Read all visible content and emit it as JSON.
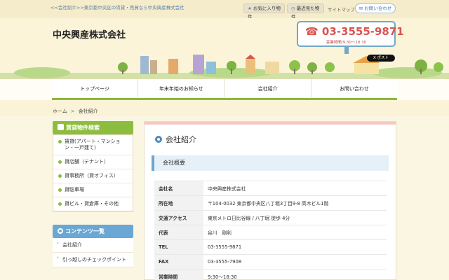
{
  "top": {
    "breadcrumb": "<<会社紹介>>東京都中央区の賃貸・売買なら中央興産株式会社",
    "favorite": "お気に入り物件",
    "recent": "最近見た物件",
    "sitemap": "サイトマップ",
    "contact": "お問い合わせ"
  },
  "header": {
    "company": "中央興産株式会社",
    "phone": "03-3555-9871",
    "hours": "営業時間/9:30〜18:30",
    "post": "X ポスト"
  },
  "nav": [
    "トップページ",
    "年末年始のお知らせ",
    "会社紹介",
    "お問い合わせ"
  ],
  "breadcrumb": {
    "home": "ホーム",
    "sep": ">",
    "current": "会社紹介"
  },
  "sidebar": {
    "rent_title": "賃貸物件検索",
    "rent_items": [
      "賃貸(アパート・マンション・一戸建て)",
      "貸店舗（テナント）",
      "貸事務所（貸オフィス）",
      "貸駐車場",
      "貸ビル・貸倉庫・その他"
    ],
    "contents_title": "コンテンツ一覧",
    "contents_items": [
      "会社紹介",
      "引っ越しのチェックポイント"
    ]
  },
  "main": {
    "title": "会社紹介",
    "section": "会社概要",
    "rows": [
      {
        "k": "会社名",
        "v": "中央興産株式会社"
      },
      {
        "k": "所在地",
        "v": "〒104-0032 東京都中央区八丁堀3丁目9-8 高木ビル1階"
      },
      {
        "k": "交通アクセス",
        "v": "東京メトロ日比谷線 / 八丁堀 徒歩 4分"
      },
      {
        "k": "代表",
        "v": "谷川　剛利"
      },
      {
        "k": "TEL",
        "v": "03-3555-9871"
      },
      {
        "k": "FAX",
        "v": "03-3555-7908"
      },
      {
        "k": "営業時間",
        "v": "9:30〜18:30"
      }
    ]
  },
  "colors": {
    "green": "#8dbd3f",
    "blue": "#6aa7d4",
    "phone": "#d9534f"
  }
}
